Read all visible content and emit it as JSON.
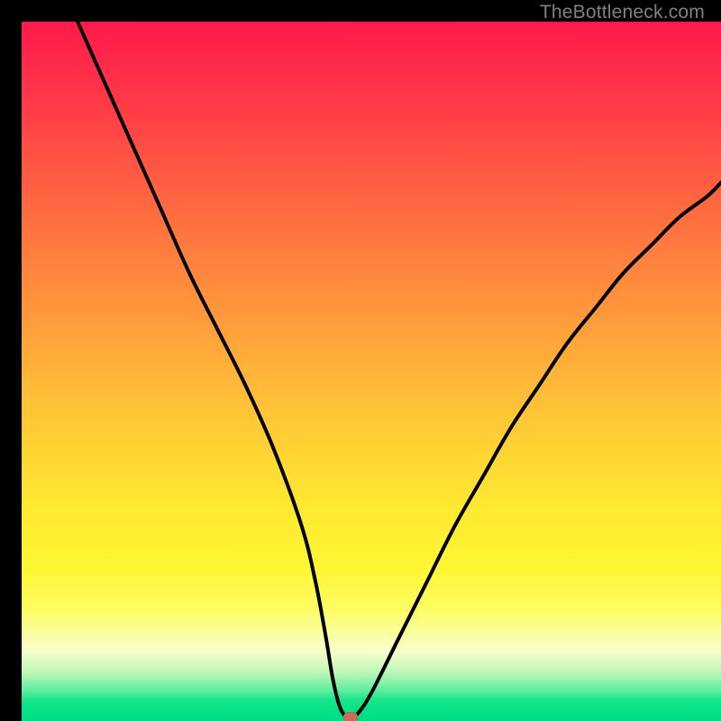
{
  "watermark": "TheBottleneck.com",
  "colors": {
    "curve": "#000000",
    "marker": "#cc6b5a",
    "frame": "#000000"
  },
  "chart_data": {
    "type": "line",
    "title": "",
    "xlabel": "",
    "ylabel": "",
    "xlim": [
      0,
      100
    ],
    "ylim": [
      0,
      100
    ],
    "grid": false,
    "legend": false,
    "series": [
      {
        "name": "bottleneck-curve",
        "x": [
          8,
          12,
          16,
          20,
          24,
          28,
          32,
          36,
          40,
          42,
          43.5,
          44.5,
          45.5,
          46.5,
          47,
          48,
          50,
          54,
          58,
          62,
          66,
          70,
          74,
          78,
          82,
          86,
          90,
          94,
          98,
          100
        ],
        "values": [
          100,
          91,
          82,
          73,
          64,
          56,
          48,
          39,
          28,
          20,
          12,
          6,
          2,
          0.5,
          0.5,
          1,
          4,
          12,
          20,
          28,
          35,
          42,
          48,
          54,
          59,
          64,
          68,
          72,
          75,
          77
        ]
      }
    ],
    "marker": {
      "x": 47,
      "y": 0.5
    },
    "background_gradient": {
      "top": "#ff1a4b",
      "mid": "#ffe833",
      "bottom": "#00de83"
    }
  }
}
